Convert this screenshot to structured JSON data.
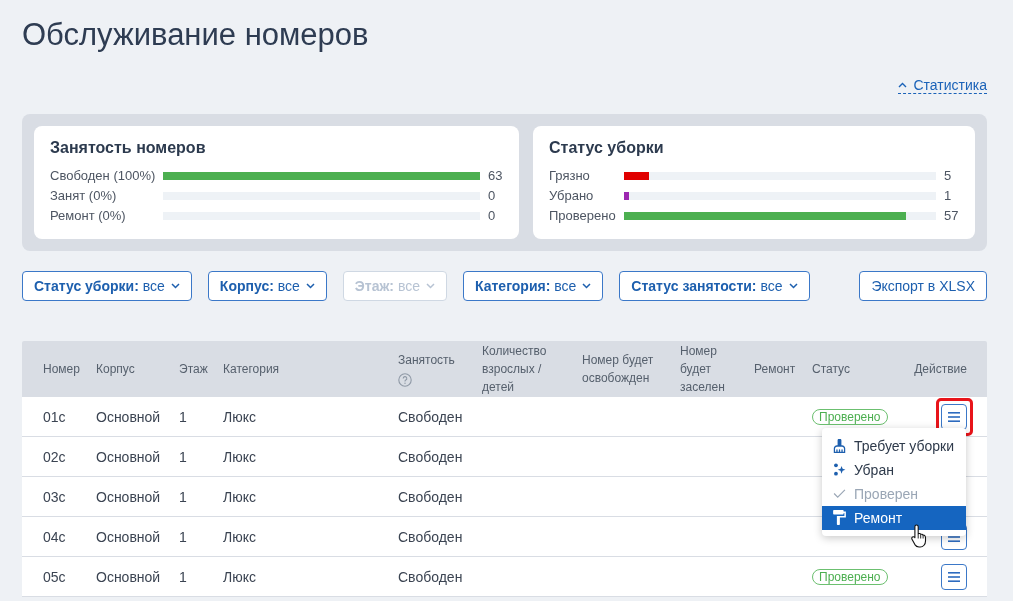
{
  "page": {
    "title": "Обслуживание номеров"
  },
  "stats_toggle": {
    "label": "Статистика",
    "expanded": true
  },
  "stats": [
    {
      "title": "Занятость номеров",
      "rows": [
        {
          "label": "Свободен (100%)",
          "level": 1,
          "count": "63"
        },
        {
          "label": "Занят (0%)",
          "level": 0,
          "count": "0"
        },
        {
          "label": "Ремонт (0%)",
          "level": 0,
          "count": "0"
        }
      ]
    },
    {
      "title": "Статус уборки",
      "rows": [
        {
          "label": "Грязно",
          "level": 0.08,
          "count": "5",
          "color": "#e00000"
        },
        {
          "label": "Убрано",
          "level": 0.016,
          "count": "1",
          "color": "#9c27b0"
        },
        {
          "label": "Проверено",
          "level": 0.905,
          "count": "57",
          "color": "#4caf50"
        }
      ]
    }
  ],
  "filters": [
    {
      "label": "Статус уборки:",
      "value": "все",
      "disabled": false
    },
    {
      "label": "Корпус:",
      "value": "все",
      "disabled": false
    },
    {
      "label": "Этаж:",
      "value": "все",
      "disabled": true
    },
    {
      "label": "Категория:",
      "value": "все",
      "disabled": false
    },
    {
      "label": "Статус занятости:",
      "value": "все",
      "disabled": false
    }
  ],
  "export_button": {
    "label": "Экспорт в XLSX"
  },
  "table": {
    "columns": [
      {
        "label": "Номер",
        "help": false
      },
      {
        "label": "Корпус",
        "help": false
      },
      {
        "label": "Этаж",
        "help": false
      },
      {
        "label": "Категория",
        "help": false
      },
      {
        "label": "Занятость",
        "help": true
      },
      {
        "label": "Количество взрослых / детей",
        "help": false
      },
      {
        "label": "Номер будет освобожден",
        "help": false
      },
      {
        "label": "Номер будет заселен",
        "help": false
      },
      {
        "label": "Ремонт",
        "help": false
      },
      {
        "label": "Статус",
        "help": false
      },
      {
        "label": "Действие",
        "help": false
      }
    ],
    "rows": [
      {
        "number": "01c",
        "building": "Основной",
        "floor": "1",
        "category": "Люкс",
        "occupancy": "Свободен",
        "status": "Проверено",
        "action_button": true,
        "highlighted": true,
        "menu": {
          "items": [
            {
              "label": "Требует уборки",
              "kind": "broom",
              "disabled": false,
              "selected": false
            },
            {
              "label": "Убран",
              "kind": "sparkle",
              "disabled": false,
              "selected": false
            },
            {
              "label": "Проверен",
              "kind": "check",
              "disabled": true,
              "selected": false
            },
            {
              "label": "Ремонт",
              "kind": "roller",
              "disabled": false,
              "selected": true
            }
          ]
        }
      },
      {
        "number": "02c",
        "building": "Основной",
        "floor": "1",
        "category": "Люкс",
        "occupancy": "Свободен",
        "action_button": false,
        "highlighted": false
      },
      {
        "number": "03c",
        "building": "Основной",
        "floor": "1",
        "category": "Люкс",
        "occupancy": "Свободен",
        "action_button": false,
        "highlighted": false
      },
      {
        "number": "04c",
        "building": "Основной",
        "floor": "1",
        "category": "Люкс",
        "occupancy": "Свободен",
        "action_button": true,
        "highlighted": false
      },
      {
        "number": "05c",
        "building": "Основной",
        "floor": "1",
        "category": "Люкс",
        "occupancy": "Свободен",
        "status": "Проверено",
        "action_button": true,
        "highlighted": false
      }
    ]
  }
}
